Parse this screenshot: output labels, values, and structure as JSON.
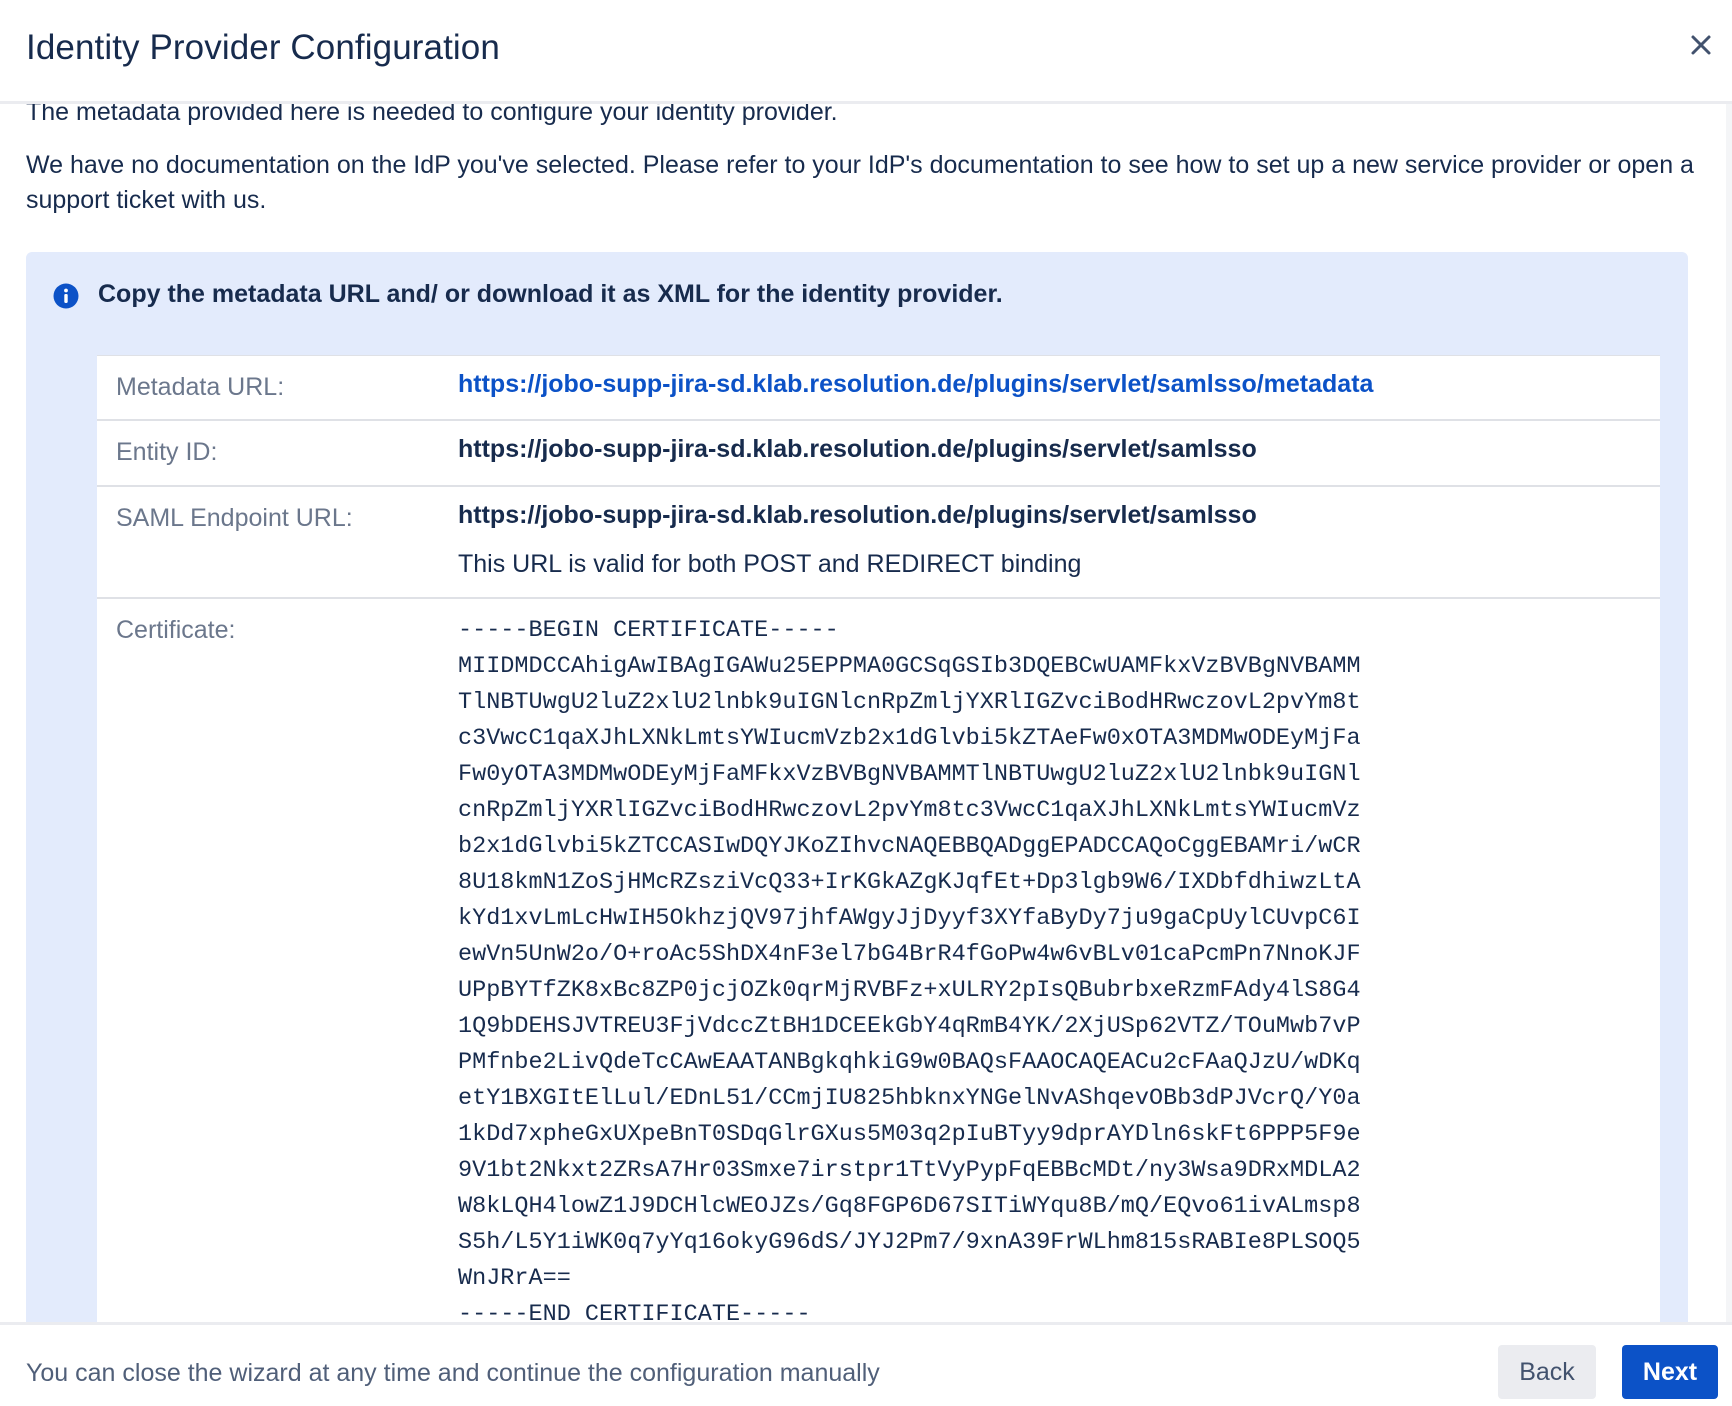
{
  "dialog": {
    "title": "Identity Provider Configuration",
    "close_icon": "close-icon"
  },
  "intro": {
    "cut_text": "The metadata provided here is needed to configure your identity provider.",
    "text": "We have no documentation on the IdP you've selected. Please refer to your IdP's documentation to see how to set up a new service provider or open a support ticket with us."
  },
  "info_panel": {
    "icon": "info-icon",
    "accent": "#0c52c7",
    "heading": "Copy the metadata URL and/ or download it as XML for the identity provider."
  },
  "metadata": {
    "metadata_url": {
      "label": "Metadata URL:",
      "value": "https://jobo-supp-jira-sd.klab.resolution.de/plugins/servlet/samlsso/metadata"
    },
    "entity_id": {
      "label": "Entity ID:",
      "value": "https://jobo-supp-jira-sd.klab.resolution.de/plugins/servlet/samlsso"
    },
    "saml_endpoint": {
      "label": "SAML Endpoint URL:",
      "value": "https://jobo-supp-jira-sd.klab.resolution.de/plugins/servlet/samlsso",
      "note": "This URL is valid for both POST and REDIRECT binding"
    },
    "certificate": {
      "label": "Certificate:",
      "value": "-----BEGIN CERTIFICATE-----\nMIIDMDCCAhigAwIBAgIGAWu25EPPMA0GCSqGSIb3DQEBCwUAMFkxVzBVBgNVBAMM\nTlNBTUwgU2luZ2xlU2lnbk9uIGNlcnRpZmljYXRlIGZvciBodHRwczovL2pvYm8t\nc3VwcC1qaXJhLXNkLmtsYWIucmVzb2x1dGlvbi5kZTAeFw0xOTA3MDMwODEyMjFa\nFw0yOTA3MDMwODEyMjFaMFkxVzBVBgNVBAMMTlNBTUwgU2luZ2xlU2lnbk9uIGNl\ncnRpZmljYXRlIGZvciBodHRwczovL2pvYm8tc3VwcC1qaXJhLXNkLmtsYWIucmVz\nb2x1dGlvbi5kZTCCASIwDQYJKoZIhvcNAQEBBQADggEPADCCAQoCggEBAMri/wCR\n8U18kmN1ZoSjHMcRZsziVcQ33+IrKGkAZgKJqfEt+Dp3lgb9W6/IXDbfdhiwzLtA\nkYd1xvLmLcHwIH5OkhzjQV97jhfAWgyJjDyyf3XYfaByDy7ju9gaCpUylCUvpC6I\newVn5UnW2o/O+roAc5ShDX4nF3el7bG4BrR4fGoPw4w6vBLv01caPcmPn7NnoKJF\nUPpBYTfZK8xBc8ZP0jcjOZk0qrMjRVBFz+xULRY2pIsQBubrbxeRzmFAdy4lS8G4\n1Q9bDEHSJVTREU3FjVdccZtBH1DCEEkGbY4qRmB4YK/2XjUSp62VTZ/TOuMwb7vP\nPMfnbe2LivQdeTcCAwEAATANBgkqhkiG9w0BAQsFAAOCAQEACu2cFAaQJzU/wDKq\netY1BXGItElLul/EDnL51/CCmjIU825hbknxYNGelNvAShqevOBb3dPJVcrQ/Y0a\n1kDd7xpheGxUXpeBnT0SDqGlrGXus5M03q2pIuBTyy9dprAYDln6skFt6PPP5F9e\n9V1bt2Nkxt2ZRsA7Hr03Smxe7irstpr1TtVyPypFqEBBcMDt/ny3Wsa9DRxMDLA2\nW8kLQH4lowZ1J9DCHlcWEOJZs/Gq8FGP6D67SITiWYqu8B/mQ/EQvo61ivALmsp8\nS5h/L5Y1iWK0q7yYq16okyG96dS/JYJ2Pm7/9xnA39FrWLhm815sRABIe8PLSOQ5\nWnJRrA==\n-----END CERTIFICATE-----"
    }
  },
  "footer": {
    "hint": "You can close the wizard at any time and continue the configuration manually",
    "back_label": "Back",
    "next_label": "Next",
    "primary_color": "#0c52c7"
  }
}
